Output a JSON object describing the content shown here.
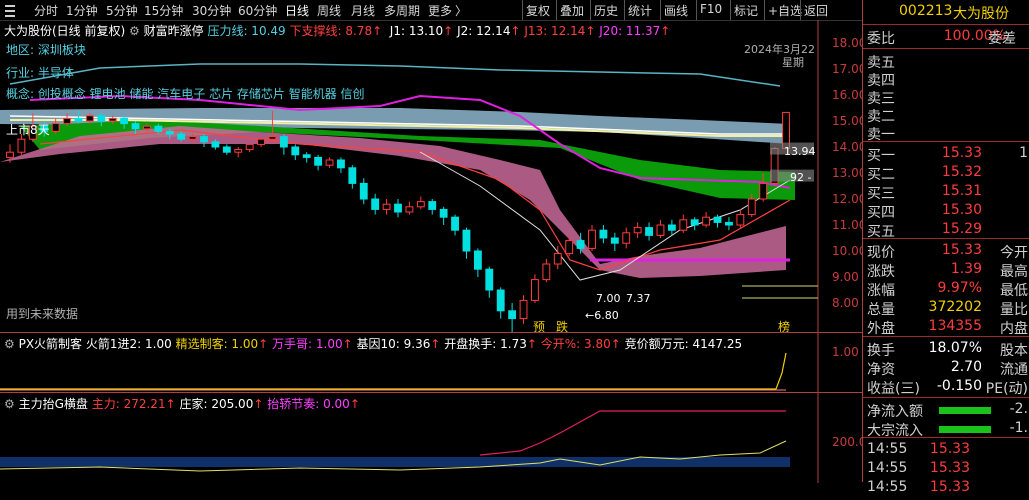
{
  "toolbar": {
    "periods": [
      "分时",
      "1分钟",
      "5分钟",
      "15分钟",
      "30分钟",
      "60分钟",
      "日线",
      "周线",
      "月线",
      "多周期",
      "更多"
    ],
    "active_period": "日线",
    "more_arrow": "〉",
    "tools": [
      "复权",
      "叠加",
      "历史",
      "统计",
      "画线",
      "F10",
      "标记",
      "+自选",
      "返回"
    ]
  },
  "header": {
    "stock_name": "大为股份(日线 前复权)",
    "indicator_name": "财富昨涨停",
    "pressure_label": "压力线: 10.49",
    "support_label": "下支撑线: 8.78",
    "support_arrow": "↑",
    "j1": "J1: 13.10",
    "j2": "J2: 12.14",
    "j13": "J13: 12.14",
    "j20": "J20: 11.37",
    "j1_arrow": "↑",
    "j2_arrow": "↑",
    "j13_arrow": "↑",
    "j20_arrow": "↑"
  },
  "info_labels": {
    "region": "地区: 深圳板块",
    "industry": "行业: 半导体",
    "concept": "概念: 创投概念 锂电池 储能 汽车电子 芯片 存储芯片 智能机器 信创",
    "listing": "上市8天",
    "future": "用到未来数据",
    "date": "2024年3月22",
    "weekday": "星期",
    "price_low": "←6.80",
    "price_1": "7.37",
    "price_2": "7.00",
    "price_mark": "13.94",
    "price_mark2": "92 -",
    "tag_yu": "预",
    "tag_die": "跌",
    "tag_bang": "榜"
  },
  "y_axis": [
    "18.00",
    "17.00",
    "16.00",
    "15.00",
    "14.00",
    "13.00",
    "12.00",
    "11.00",
    "10.00",
    "9.00",
    "8.00"
  ],
  "panel2": {
    "title": "PX火箭制客",
    "v1": "火箭1进2: 1.00",
    "v2": "精选制客: 1.00",
    "v3": "万手哥: 1.00",
    "v4": "基因10: 9.36",
    "v5": "开盘换手: 1.73",
    "v6": "今开%: 3.80",
    "v7": "竞价额万元: 4147.25",
    "v2_arrow": "↑",
    "v3_arrow": "↑",
    "v4_arrow": "↑",
    "v5_arrow": "↑",
    "v6_arrow": "↑",
    "y_label": "1.00"
  },
  "panel3": {
    "title": "主力抬G横盘",
    "v1": "主力: 272.21",
    "v2": "庄家: 205.00",
    "v3": "抬轿节奏: 0.00",
    "v1_arrow": "↑",
    "v2_arrow": "↑",
    "v3_arrow": "↑",
    "y_label": "200.0"
  },
  "right_panel": {
    "code": "002213",
    "name": "大为股份",
    "weibi_label": "委比",
    "weibi_value": "100.00%",
    "weicha_label": "委差",
    "sells": [
      "卖五",
      "卖四",
      "卖三",
      "卖二",
      "卖一"
    ],
    "buys": [
      {
        "label": "买一",
        "price": "15.33",
        "vol": "1"
      },
      {
        "label": "买二",
        "price": "15.32",
        "vol": ""
      },
      {
        "label": "买三",
        "price": "15.31",
        "vol": ""
      },
      {
        "label": "买四",
        "price": "15.30",
        "vol": ""
      },
      {
        "label": "买五",
        "price": "15.29",
        "vol": ""
      }
    ],
    "stats": [
      {
        "l1": "现价",
        "v1": "15.33",
        "l2": "今开",
        "c": "num-red"
      },
      {
        "l1": "涨跌",
        "v1": "1.39",
        "l2": "最高",
        "c": "num-red"
      },
      {
        "l1": "涨幅",
        "v1": "9.97%",
        "l2": "最低",
        "c": "num-red"
      },
      {
        "l1": "总量",
        "v1": "372202",
        "l2": "量比",
        "c": "num-yellow"
      },
      {
        "l1": "外盘",
        "v1": "134355",
        "l2": "内盘",
        "c": "num-red"
      }
    ],
    "stats2": [
      {
        "l1": "换手",
        "v1": "18.07%",
        "l2": "股本"
      },
      {
        "l1": "净资",
        "v1": "2.70",
        "l2": "流通"
      },
      {
        "l1": "收益(三)",
        "v1": "-0.150",
        "l2": "PE(动)"
      }
    ],
    "flows": [
      {
        "label": "净流入额",
        "value": "-2."
      },
      {
        "label": "大宗流入",
        "value": "-1."
      }
    ],
    "ticks": [
      {
        "time": "14:55",
        "price": "15.33"
      },
      {
        "time": "14:55",
        "price": "15.33"
      },
      {
        "time": "14:55",
        "price": "15.33"
      }
    ]
  },
  "colors": {
    "up": "#ff3c3c",
    "down": "#00e0e0",
    "band_green": "#0a9a0a",
    "band_pink": "#c86a9a",
    "band_blue": "#8fb7cf",
    "magenta": "#e020e0"
  },
  "chart_data": {
    "type": "candlestick",
    "y_range": [
      7.5,
      18.5
    ],
    "candles": [
      {
        "o": 13.6,
        "c": 13.8,
        "h": 14.1,
        "l": 13.4
      },
      {
        "o": 13.8,
        "c": 14.3,
        "h": 14.5,
        "l": 13.7
      },
      {
        "o": 14.3,
        "c": 14.8,
        "h": 15.3,
        "l": 14.2
      },
      {
        "o": 14.8,
        "c": 14.6,
        "h": 15.0,
        "l": 14.4
      },
      {
        "o": 14.6,
        "c": 14.9,
        "h": 15.1,
        "l": 14.5
      },
      {
        "o": 14.9,
        "c": 15.1,
        "h": 15.3,
        "l": 14.8
      },
      {
        "o": 15.1,
        "c": 15.0,
        "h": 15.4,
        "l": 14.9
      },
      {
        "o": 15.0,
        "c": 15.2,
        "h": 15.3,
        "l": 14.9
      },
      {
        "o": 15.2,
        "c": 15.0,
        "h": 15.3,
        "l": 14.8
      },
      {
        "o": 15.0,
        "c": 15.1,
        "h": 15.2,
        "l": 14.9
      },
      {
        "o": 15.1,
        "c": 14.9,
        "h": 15.2,
        "l": 14.7
      },
      {
        "o": 14.9,
        "c": 14.7,
        "h": 15.0,
        "l": 14.5
      },
      {
        "o": 14.7,
        "c": 14.8,
        "h": 14.9,
        "l": 14.6
      },
      {
        "o": 14.8,
        "c": 14.6,
        "h": 14.9,
        "l": 14.5
      },
      {
        "o": 14.6,
        "c": 14.5,
        "h": 14.7,
        "l": 14.3
      },
      {
        "o": 14.5,
        "c": 14.3,
        "h": 14.6,
        "l": 14.2
      },
      {
        "o": 14.3,
        "c": 14.4,
        "h": 14.5,
        "l": 14.2
      },
      {
        "o": 14.4,
        "c": 14.2,
        "h": 14.5,
        "l": 14.0
      },
      {
        "o": 14.2,
        "c": 14.0,
        "h": 14.3,
        "l": 13.9
      },
      {
        "o": 14.0,
        "c": 13.8,
        "h": 14.1,
        "l": 13.7
      },
      {
        "o": 13.8,
        "c": 13.9,
        "h": 14.0,
        "l": 13.6
      },
      {
        "o": 13.9,
        "c": 14.1,
        "h": 14.2,
        "l": 13.8
      },
      {
        "o": 14.1,
        "c": 14.3,
        "h": 14.4,
        "l": 14.0
      },
      {
        "o": 14.3,
        "c": 14.4,
        "h": 15.4,
        "l": 14.2
      },
      {
        "o": 14.4,
        "c": 14.0,
        "h": 14.5,
        "l": 13.7
      },
      {
        "o": 14.0,
        "c": 13.7,
        "h": 14.1,
        "l": 13.5
      },
      {
        "o": 13.7,
        "c": 13.6,
        "h": 13.8,
        "l": 13.4
      },
      {
        "o": 13.6,
        "c": 13.3,
        "h": 13.7,
        "l": 13.1
      },
      {
        "o": 13.3,
        "c": 13.5,
        "h": 13.6,
        "l": 13.2
      },
      {
        "o": 13.5,
        "c": 13.2,
        "h": 13.6,
        "l": 13.0
      },
      {
        "o": 13.2,
        "c": 12.6,
        "h": 13.3,
        "l": 12.4
      },
      {
        "o": 12.6,
        "c": 12.0,
        "h": 12.8,
        "l": 11.8
      },
      {
        "o": 12.0,
        "c": 11.6,
        "h": 12.2,
        "l": 11.4
      },
      {
        "o": 11.6,
        "c": 11.8,
        "h": 12.0,
        "l": 11.4
      },
      {
        "o": 11.8,
        "c": 11.5,
        "h": 12.0,
        "l": 11.3
      },
      {
        "o": 11.5,
        "c": 11.7,
        "h": 11.9,
        "l": 11.4
      },
      {
        "o": 11.7,
        "c": 11.9,
        "h": 12.1,
        "l": 11.6
      },
      {
        "o": 11.9,
        "c": 11.6,
        "h": 12.0,
        "l": 11.4
      },
      {
        "o": 11.6,
        "c": 11.3,
        "h": 11.7,
        "l": 11.0
      },
      {
        "o": 11.3,
        "c": 10.8,
        "h": 11.4,
        "l": 10.6
      },
      {
        "o": 10.8,
        "c": 10.0,
        "h": 10.9,
        "l": 9.7
      },
      {
        "o": 10.0,
        "c": 9.3,
        "h": 10.1,
        "l": 9.0
      },
      {
        "o": 9.3,
        "c": 8.5,
        "h": 9.4,
        "l": 8.2
      },
      {
        "o": 8.5,
        "c": 7.7,
        "h": 8.6,
        "l": 7.4
      },
      {
        "o": 7.7,
        "c": 7.4,
        "h": 8.0,
        "l": 6.8
      },
      {
        "o": 7.4,
        "c": 8.1,
        "h": 8.3,
        "l": 7.2
      },
      {
        "o": 8.1,
        "c": 8.9,
        "h": 9.1,
        "l": 8.0
      },
      {
        "o": 8.9,
        "c": 9.5,
        "h": 9.7,
        "l": 8.8
      },
      {
        "o": 9.5,
        "c": 9.9,
        "h": 10.2,
        "l": 9.3
      },
      {
        "o": 9.9,
        "c": 10.4,
        "h": 10.6,
        "l": 9.8
      },
      {
        "o": 10.4,
        "c": 10.1,
        "h": 10.7,
        "l": 9.9
      },
      {
        "o": 10.1,
        "c": 10.8,
        "h": 11.0,
        "l": 10.0
      },
      {
        "o": 10.8,
        "c": 10.5,
        "h": 11.0,
        "l": 10.3
      },
      {
        "o": 10.5,
        "c": 10.3,
        "h": 10.7,
        "l": 10.0
      },
      {
        "o": 10.3,
        "c": 10.7,
        "h": 10.9,
        "l": 10.1
      },
      {
        "o": 10.7,
        "c": 10.9,
        "h": 11.1,
        "l": 10.5
      },
      {
        "o": 10.9,
        "c": 10.6,
        "h": 11.1,
        "l": 10.4
      },
      {
        "o": 10.6,
        "c": 11.0,
        "h": 11.2,
        "l": 10.5
      },
      {
        "o": 11.0,
        "c": 10.8,
        "h": 11.2,
        "l": 10.6
      },
      {
        "o": 10.8,
        "c": 11.2,
        "h": 11.4,
        "l": 10.7
      },
      {
        "o": 11.2,
        "c": 11.0,
        "h": 11.3,
        "l": 10.8
      },
      {
        "o": 11.0,
        "c": 11.3,
        "h": 11.5,
        "l": 10.9
      },
      {
        "o": 11.3,
        "c": 11.1,
        "h": 11.4,
        "l": 10.9
      },
      {
        "o": 11.1,
        "c": 11.0,
        "h": 11.3,
        "l": 10.8
      },
      {
        "o": 11.0,
        "c": 11.4,
        "h": 11.6,
        "l": 10.9
      },
      {
        "o": 11.4,
        "c": 12.0,
        "h": 12.2,
        "l": 11.3
      },
      {
        "o": 12.0,
        "c": 12.6,
        "h": 13.0,
        "l": 11.9
      },
      {
        "o": 12.6,
        "c": 13.94,
        "h": 14.0,
        "l": 12.5
      },
      {
        "o": 13.94,
        "c": 15.33,
        "h": 15.33,
        "l": 14.0
      }
    ]
  }
}
